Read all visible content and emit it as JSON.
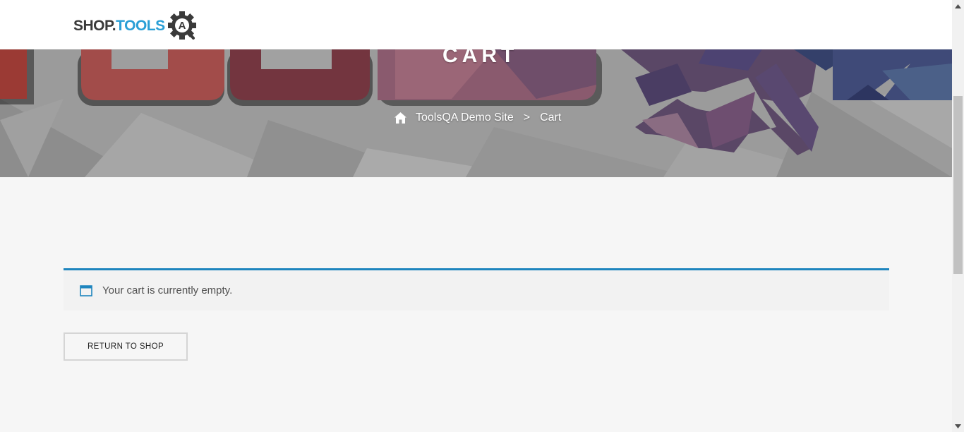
{
  "header": {
    "logo_text_shop": "SHOP.",
    "logo_text_tools": "TOOLS",
    "logo_gear_letter": "A",
    "brand_colors": {
      "shop": "#3a3a3a",
      "tools": "#2a9fd6"
    }
  },
  "banner": {
    "page_title": "CART",
    "breadcrumb": {
      "home_icon": "home-icon",
      "site": "ToolsQA Demo Site",
      "separator": ">",
      "current": "Cart"
    }
  },
  "cart": {
    "notice_icon": "window-icon",
    "empty_message": "Your cart is currently empty.",
    "return_button": "RETURN TO SHOP",
    "accent_color": "#1e85be"
  },
  "scrollbar": {
    "up_icon": "arrow-up-icon",
    "down_icon": "arrow-down-icon"
  }
}
